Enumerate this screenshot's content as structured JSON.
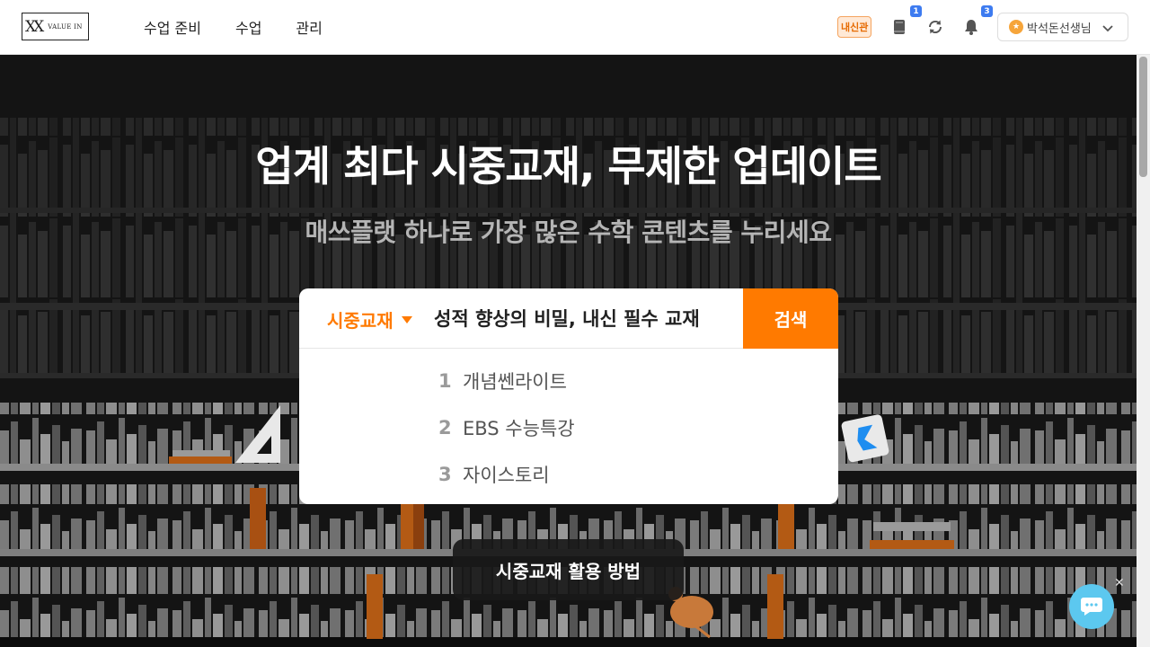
{
  "header": {
    "logo_text": "VALUE IN",
    "nav": [
      "수업 준비",
      "수업",
      "관리"
    ],
    "badge": "내신관",
    "book_count": "1",
    "notification_count": "3",
    "user_name": "박석돈선생님",
    "icons": [
      "book-icon",
      "sync-icon",
      "bell-icon",
      "chevron-down-icon"
    ]
  },
  "hero": {
    "title": "업계 최다 시중교재, 무제한 업데이트",
    "subtitle": "매쓰플랫 하나로 가장 많은 수학 콘텐츠를 누리세요",
    "search": {
      "category": "시중교재",
      "value": "성적 향상의 비밀, 내신 필수 교재",
      "button": "검색",
      "suggestions": [
        {
          "rank": "1",
          "label": "개념쎈라이트"
        },
        {
          "rank": "2",
          "label": "EBS 수능특강"
        },
        {
          "rank": "3",
          "label": "자이스토리"
        }
      ]
    },
    "howto_button": "시중교재 활용 방법"
  },
  "colors": {
    "accent": "#ff7a00",
    "badge_blue": "#3d7bf0",
    "chat": "#5cc8ef"
  }
}
